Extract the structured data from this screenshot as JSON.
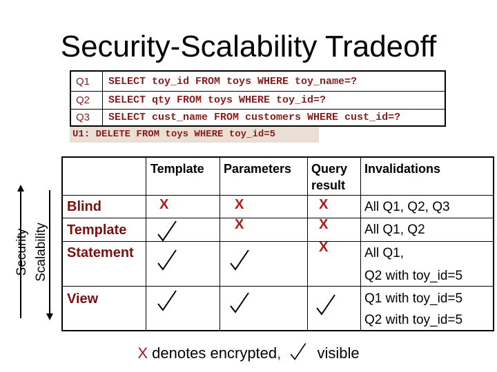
{
  "title": "Security-Scalability Tradeoff",
  "queries": [
    {
      "id": "Q1",
      "sql": "SELECT toy_id FROM toys WHERE toy_name=?"
    },
    {
      "id": "Q2",
      "sql": "SELECT qty FROM toys WHERE toy_id=?"
    },
    {
      "id": "Q3",
      "sql": "SELECT cust_name FROM customers WHERE cust_id=?"
    }
  ],
  "update": "U1: DELETE FROM toys WHERE toy_id=5",
  "axes": {
    "security_label": "Security",
    "scalability_label": "Scalability"
  },
  "table": {
    "headers": [
      "Template",
      "Parameters",
      "Query",
      "result",
      "Invalidations"
    ],
    "rows": [
      {
        "label": "Blind",
        "template": "encrypted",
        "parameters": "encrypted",
        "query_result": "encrypted",
        "invalidations": [
          "All Q1, Q2, Q3"
        ]
      },
      {
        "label": "Template",
        "template": "visible",
        "parameters": "encrypted",
        "query_result": "encrypted",
        "invalidations": [
          "All Q1, Q2"
        ]
      },
      {
        "label": "Statement",
        "template": "visible",
        "parameters": "visible",
        "query_result": "encrypted",
        "invalidations": [
          "All Q1,",
          "Q2 with toy_id=5"
        ]
      },
      {
        "label": "View",
        "template": "visible",
        "parameters": "visible",
        "query_result": "visible",
        "invalidations": [
          "Q1 with toy_id=5",
          "Q2 with toy_id=5"
        ]
      }
    ],
    "encrypted_glyph": "X"
  },
  "legend": {
    "x_glyph": "X",
    "encrypted_text": " denotes encrypted",
    "comma": ",",
    "visible_text": "visible"
  },
  "colors": {
    "sql_text": "#8b1a1a",
    "row_label": "#7a1010",
    "encrypted_mark": "#b01818",
    "update_bg": "#eaded5"
  }
}
